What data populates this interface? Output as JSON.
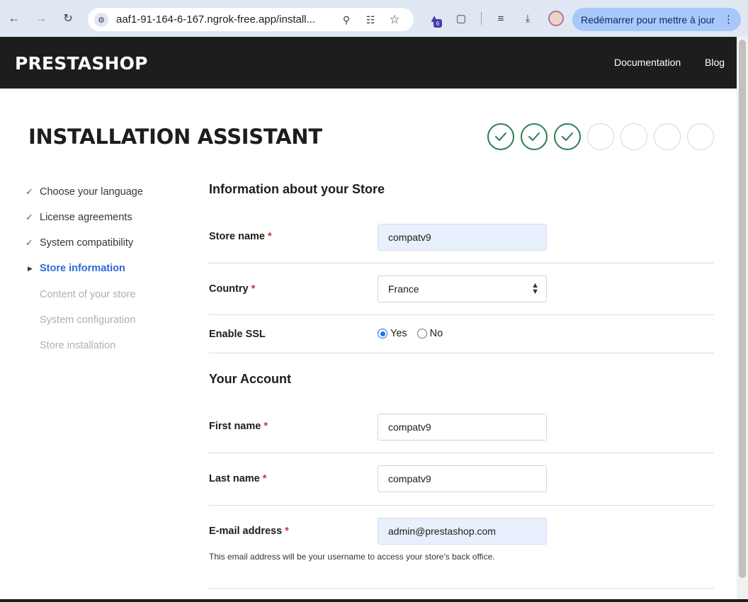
{
  "browser": {
    "url": "aaf1-91-164-6-167.ngrok-free.app/install...",
    "extension_badge": "6",
    "restart_button": "Redémarrer pour mettre à jour"
  },
  "header": {
    "logo": "PRESTASHOP",
    "links": [
      "Documentation",
      "Blog"
    ]
  },
  "title": "INSTALLATION ASSISTANT",
  "progress": {
    "completed_steps": 3,
    "total_steps": 7
  },
  "sidebar": {
    "items": [
      {
        "label": "Choose your language",
        "state": "done"
      },
      {
        "label": "License agreements",
        "state": "done"
      },
      {
        "label": "System compatibility",
        "state": "done"
      },
      {
        "label": "Store information",
        "state": "current"
      },
      {
        "label": "Content of your store",
        "state": "todo"
      },
      {
        "label": "System configuration",
        "state": "todo"
      },
      {
        "label": "Store installation",
        "state": "todo"
      }
    ]
  },
  "store_section": {
    "title": "Information about your Store",
    "store_name": {
      "label": "Store name",
      "required": "*",
      "value": "compatv9"
    },
    "country": {
      "label": "Country",
      "required": "*",
      "value": "France"
    },
    "ssl": {
      "label": "Enable SSL",
      "options": [
        "Yes",
        "No"
      ],
      "selected": "Yes"
    }
  },
  "account_section": {
    "title": "Your Account",
    "first_name": {
      "label": "First name",
      "required": "*",
      "value": "compatv9"
    },
    "last_name": {
      "label": "Last name",
      "required": "*",
      "value": "compatv9"
    },
    "email": {
      "label": "E-mail address",
      "required": "*",
      "value": "admin@prestashop.com"
    },
    "email_help": "This email address will be your username to access your store's back office."
  },
  "colors": {
    "header_bg": "#1d1d1b",
    "accent_green": "#2e7d4f",
    "current_step_blue": "#2d6ad6",
    "required_red": "#c0392b",
    "autofill_bg": "#e8f0fe"
  }
}
